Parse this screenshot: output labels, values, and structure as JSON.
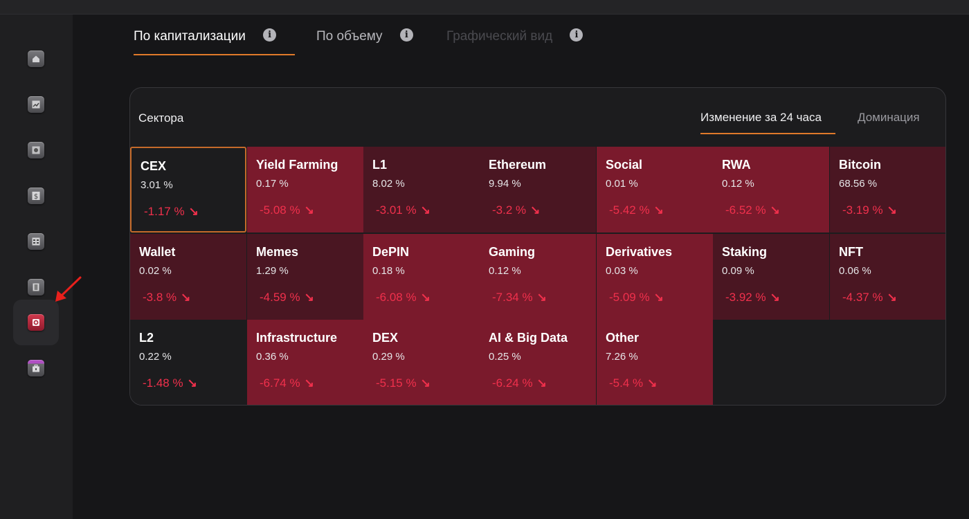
{
  "colors": {
    "accent": "#e07a2a",
    "negative": "#f0304c",
    "tile_bright": "#7a1a2c",
    "tile_dark": "#4a1622"
  },
  "sidebar": {
    "items": [
      {
        "icon": "home-icon"
      },
      {
        "icon": "chart-up-icon"
      },
      {
        "icon": "safe-icon"
      },
      {
        "icon": "dollar-icon"
      },
      {
        "icon": "calculator-icon"
      },
      {
        "icon": "building-icon"
      },
      {
        "icon": "sectors-icon",
        "active": true
      },
      {
        "icon": "briefcase-icon"
      }
    ]
  },
  "tabs": [
    {
      "label": "По капитализации",
      "active": true
    },
    {
      "label": "По объему"
    },
    {
      "label": "Графический вид",
      "disabled": true
    }
  ],
  "info_glyph": "i",
  "card": {
    "title": "Сектора",
    "tab_change": "Изменение за 24 часа",
    "tab_dominance": "Доминация"
  },
  "sectors": [
    {
      "name": "CEX",
      "share": "3.01 %",
      "change": "-1.17 %",
      "arrow": "↘"
    },
    {
      "name": "Yield Farming",
      "share": "0.17 %",
      "change": "-5.08 %",
      "arrow": "↘"
    },
    {
      "name": "L1",
      "share": "8.02 %",
      "change": "-3.01 %",
      "arrow": "↘"
    },
    {
      "name": "Ethereum",
      "share": "9.94 %",
      "change": "-3.2 %",
      "arrow": "↘"
    },
    {
      "name": "Social",
      "share": "0.01 %",
      "change": "-5.42 %",
      "arrow": "↘"
    },
    {
      "name": "RWA",
      "share": "0.12 %",
      "change": "-6.52 %",
      "arrow": "↘"
    },
    {
      "name": "Bitcoin",
      "share": "68.56 %",
      "change": "-3.19 %",
      "arrow": "↘"
    },
    {
      "name": "Wallet",
      "share": "0.02 %",
      "change": "-3.8 %",
      "arrow": "↘"
    },
    {
      "name": "Memes",
      "share": "1.29 %",
      "change": "-4.59 %",
      "arrow": "↘"
    },
    {
      "name": "DePIN",
      "share": "0.18 %",
      "change": "-6.08 %",
      "arrow": "↘"
    },
    {
      "name": "Gaming",
      "share": "0.12 %",
      "change": "-7.34 %",
      "arrow": "↘"
    },
    {
      "name": "Derivatives",
      "share": "0.03 %",
      "change": "-5.09 %",
      "arrow": "↘"
    },
    {
      "name": "Staking",
      "share": "0.09 %",
      "change": "-3.92 %",
      "arrow": "↘"
    },
    {
      "name": "NFT",
      "share": "0.06 %",
      "change": "-4.37 %",
      "arrow": "↘"
    },
    {
      "name": "L2",
      "share": "0.22 %",
      "change": "-1.48 %",
      "arrow": "↘"
    },
    {
      "name": "Infrastructure",
      "share": "0.36 %",
      "change": "-6.74 %",
      "arrow": "↘"
    },
    {
      "name": "DEX",
      "share": "0.29 %",
      "change": "-5.15 %",
      "arrow": "↘"
    },
    {
      "name": "AI & Big Data",
      "share": "0.25 %",
      "change": "-6.24 %",
      "arrow": "↘"
    },
    {
      "name": "Other",
      "share": "7.26 %",
      "change": "-5.4 %",
      "arrow": "↘"
    }
  ]
}
